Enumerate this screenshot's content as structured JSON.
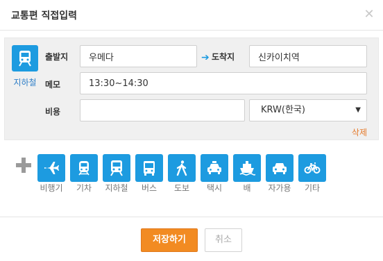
{
  "dialog": {
    "title": "교통편 직접입력",
    "close_icon": "close-icon"
  },
  "entry": {
    "mode_icon": "subway-icon",
    "mode_label": "지하철",
    "departure_label": "출발지",
    "departure_value": "우메다",
    "arrival_label": "도착지",
    "arrival_value": "신카이치역",
    "memo_label": "메모",
    "memo_value": "13:30~14:30",
    "cost_label": "비용",
    "cost_value": "",
    "currency_selected": "KRW(한국)",
    "delete_label": "삭제"
  },
  "transport": {
    "add_icon": "plus-icon",
    "options": [
      {
        "label": "비행기",
        "icon": "airplane-icon"
      },
      {
        "label": "기차",
        "icon": "train-icon"
      },
      {
        "label": "지하철",
        "icon": "subway-icon"
      },
      {
        "label": "버스",
        "icon": "bus-icon"
      },
      {
        "label": "도보",
        "icon": "walk-icon"
      },
      {
        "label": "택시",
        "icon": "taxi-icon"
      },
      {
        "label": "배",
        "icon": "ship-icon"
      },
      {
        "label": "자가용",
        "icon": "car-icon"
      },
      {
        "label": "기타",
        "icon": "bicycle-icon"
      }
    ]
  },
  "actions": {
    "save_label": "저장하기",
    "cancel_label": "취소"
  },
  "colors": {
    "accent": "#1d9be0",
    "save": "#f28b22",
    "delete": "#e57a2b"
  }
}
